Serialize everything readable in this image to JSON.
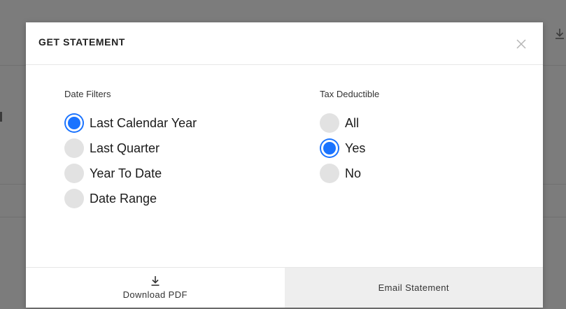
{
  "modal": {
    "title": "GET STATEMENT"
  },
  "date_filters": {
    "label": "Date Filters",
    "options": [
      {
        "label": "Last Calendar Year",
        "checked": true
      },
      {
        "label": "Last Quarter",
        "checked": false
      },
      {
        "label": "Year To Date",
        "checked": false
      },
      {
        "label": "Date Range",
        "checked": false
      }
    ]
  },
  "tax_deductible": {
    "label": "Tax Deductible",
    "options": [
      {
        "label": "All",
        "checked": false
      },
      {
        "label": "Yes",
        "checked": true
      },
      {
        "label": "No",
        "checked": false
      }
    ]
  },
  "footer": {
    "download_label": "Download PDF",
    "email_label": "Email Statement"
  },
  "colors": {
    "accent": "#1a73ff",
    "unchecked": "#e2e2e2",
    "overlay": "#7c7c7c"
  },
  "icons": {
    "close": "close-icon",
    "download": "download-icon"
  }
}
